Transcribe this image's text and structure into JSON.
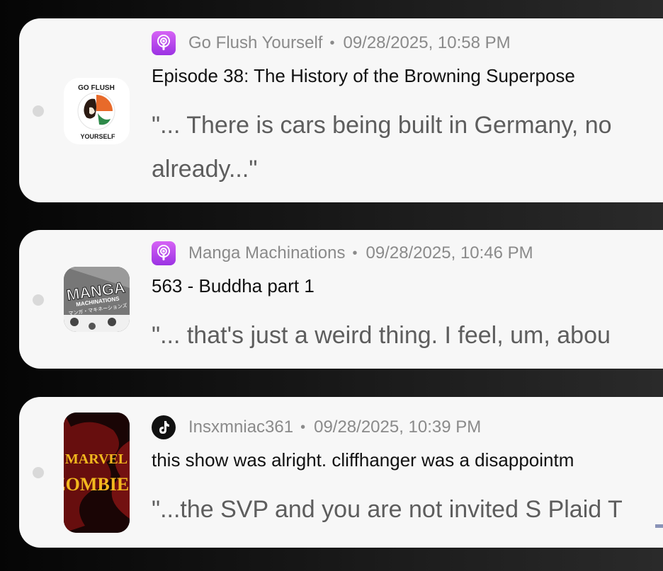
{
  "feed": {
    "items": [
      {
        "source_icon": "podcast-icon",
        "source": "Go Flush Yourself",
        "separator": "•",
        "timestamp": "09/28/2025, 10:58 PM",
        "title": "Episode 38: The History of the Browning Superpose",
        "snippet": "\"... There is cars being built in Germany, no\nalready...\"",
        "thumbnail_text": [
          "GO FLUSH",
          "YOURSELF"
        ]
      },
      {
        "source_icon": "podcast-icon",
        "source": "Manga Machinations",
        "separator": "•",
        "timestamp": "09/28/2025, 10:46 PM",
        "title": "563 - Buddha part 1",
        "snippet": "\"... that's just a weird thing. I feel, um, abou",
        "thumbnail_text": [
          "MANGA",
          "MACHINATIONS",
          "マンガ・マキネーションズ"
        ]
      },
      {
        "source_icon": "tiktok-icon",
        "source": "Insxmniac361",
        "separator": "•",
        "timestamp": "09/28/2025, 10:39 PM",
        "title": "this show was alright. cliffhanger was a disappointm",
        "snippet": "\"...the SVP and you are not invited S Plaid T",
        "thumbnail_text": [
          "MARVEL",
          "ZOMBIES"
        ]
      }
    ]
  },
  "colors": {
    "card_bg": "#f7f7f7",
    "podcast_purple": "#b14ae8",
    "tiktok_black": "#111111",
    "meta_gray": "#8a8a8a",
    "snippet_gray": "#5d5d5d"
  }
}
